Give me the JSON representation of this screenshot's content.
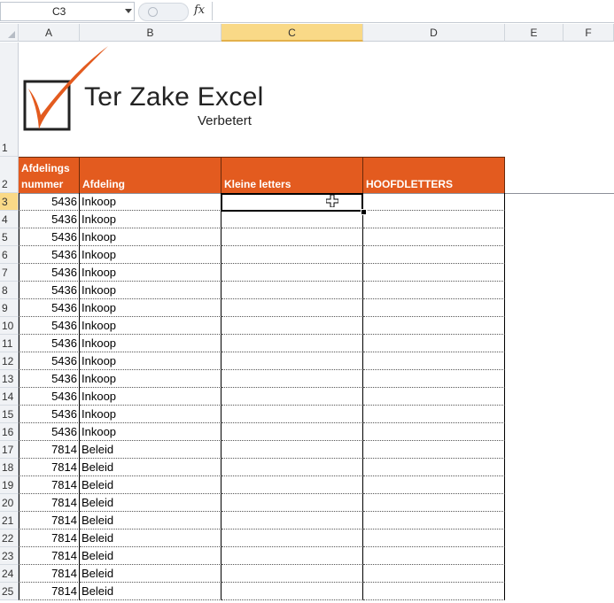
{
  "name_box": "C3",
  "formula_bar": {
    "fx_label": "fx",
    "content": ""
  },
  "columns": [
    "A",
    "B",
    "C",
    "D",
    "E",
    "F"
  ],
  "selected_column": "C",
  "selected_row": "3",
  "rows": [
    "1",
    "2",
    "3",
    "4",
    "5",
    "6",
    "7",
    "8",
    "9",
    "10",
    "11",
    "12",
    "13",
    "14",
    "15",
    "16",
    "17",
    "18",
    "19",
    "20",
    "21",
    "22",
    "23",
    "24",
    "25"
  ],
  "logo": {
    "title": "Ter Zake Excel",
    "subtitle": "Verbetert",
    "accent_color": "#e35b1f"
  },
  "table_header": {
    "col_a_line1": "Afdelings",
    "col_a_line2": "nummer",
    "col_b": "Afdeling",
    "col_c": "Kleine letters",
    "col_d": "HOOFDLETTERS",
    "fill_color": "#e35b1f"
  },
  "data_rows": [
    {
      "nummer": "5436",
      "afdeling": "Inkoop",
      "kleine": "",
      "hoofd": ""
    },
    {
      "nummer": "5436",
      "afdeling": "Inkoop",
      "kleine": "",
      "hoofd": ""
    },
    {
      "nummer": "5436",
      "afdeling": "Inkoop",
      "kleine": "",
      "hoofd": ""
    },
    {
      "nummer": "5436",
      "afdeling": "Inkoop",
      "kleine": "",
      "hoofd": ""
    },
    {
      "nummer": "5436",
      "afdeling": "Inkoop",
      "kleine": "",
      "hoofd": ""
    },
    {
      "nummer": "5436",
      "afdeling": "Inkoop",
      "kleine": "",
      "hoofd": ""
    },
    {
      "nummer": "5436",
      "afdeling": "Inkoop",
      "kleine": "",
      "hoofd": ""
    },
    {
      "nummer": "5436",
      "afdeling": "Inkoop",
      "kleine": "",
      "hoofd": ""
    },
    {
      "nummer": "5436",
      "afdeling": "Inkoop",
      "kleine": "",
      "hoofd": ""
    },
    {
      "nummer": "5436",
      "afdeling": "Inkoop",
      "kleine": "",
      "hoofd": ""
    },
    {
      "nummer": "5436",
      "afdeling": "Inkoop",
      "kleine": "",
      "hoofd": ""
    },
    {
      "nummer": "5436",
      "afdeling": "Inkoop",
      "kleine": "",
      "hoofd": ""
    },
    {
      "nummer": "5436",
      "afdeling": "Inkoop",
      "kleine": "",
      "hoofd": ""
    },
    {
      "nummer": "5436",
      "afdeling": "Inkoop",
      "kleine": "",
      "hoofd": ""
    },
    {
      "nummer": "7814",
      "afdeling": "Beleid",
      "kleine": "",
      "hoofd": ""
    },
    {
      "nummer": "7814",
      "afdeling": "Beleid",
      "kleine": "",
      "hoofd": ""
    },
    {
      "nummer": "7814",
      "afdeling": "Beleid",
      "kleine": "",
      "hoofd": ""
    },
    {
      "nummer": "7814",
      "afdeling": "Beleid",
      "kleine": "",
      "hoofd": ""
    },
    {
      "nummer": "7814",
      "afdeling": "Beleid",
      "kleine": "",
      "hoofd": ""
    },
    {
      "nummer": "7814",
      "afdeling": "Beleid",
      "kleine": "",
      "hoofd": ""
    },
    {
      "nummer": "7814",
      "afdeling": "Beleid",
      "kleine": "",
      "hoofd": ""
    },
    {
      "nummer": "7814",
      "afdeling": "Beleid",
      "kleine": "",
      "hoofd": ""
    },
    {
      "nummer": "7814",
      "afdeling": "Beleid",
      "kleine": "",
      "hoofd": ""
    }
  ]
}
